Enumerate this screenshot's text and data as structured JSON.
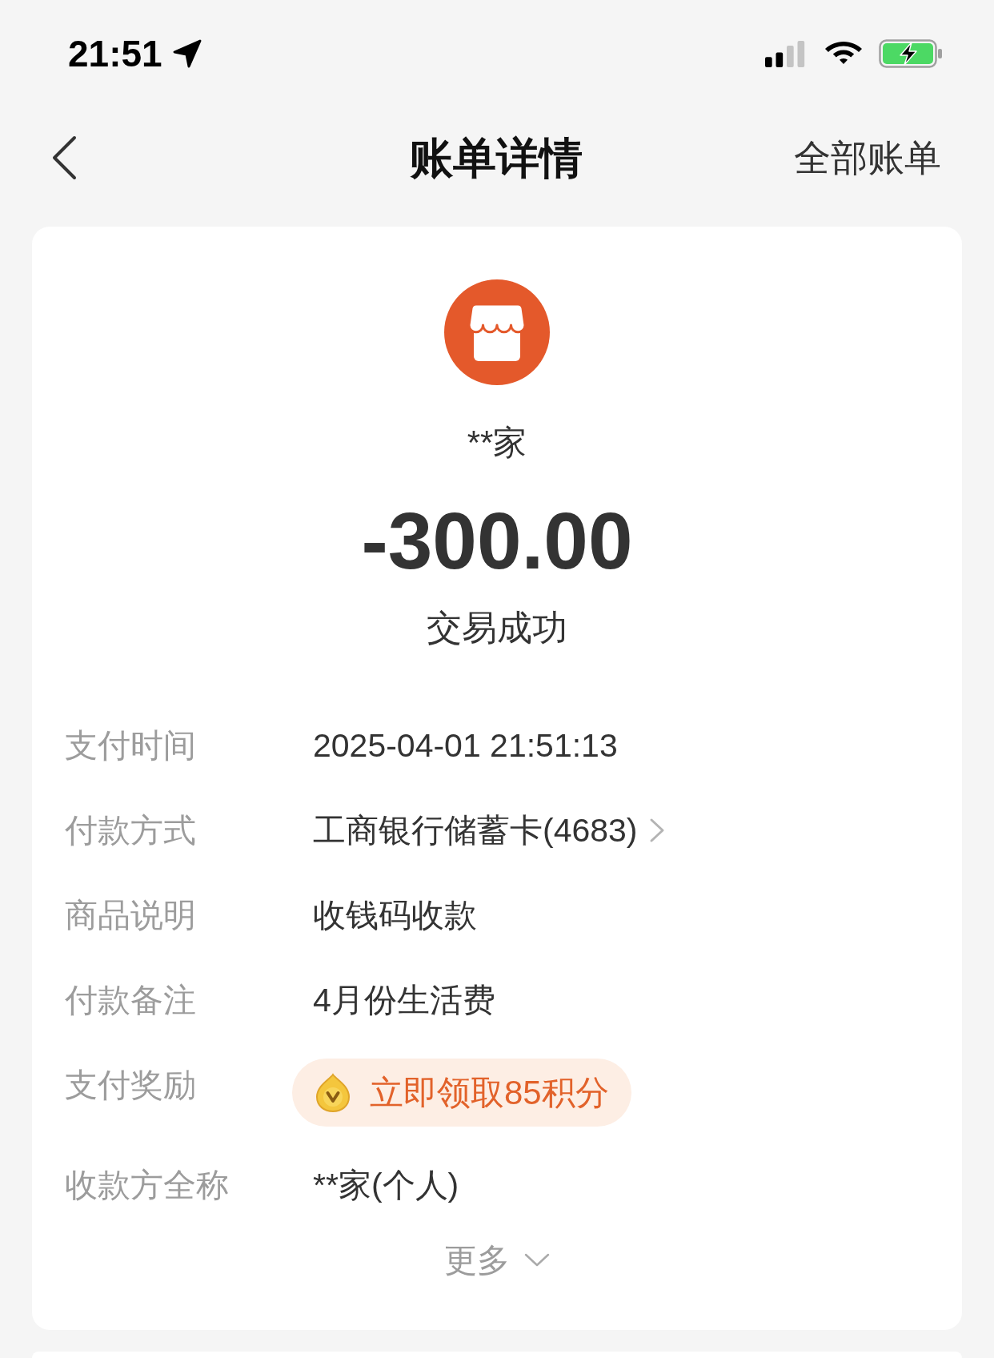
{
  "status_bar": {
    "time": "21:51"
  },
  "nav": {
    "title": "账单详情",
    "action": "全部账单"
  },
  "summary": {
    "merchant": "**家",
    "amount": "-300.00",
    "status": "交易成功"
  },
  "details": [
    {
      "kind": "text",
      "label": "支付时间",
      "value": "2025-04-01 21:51:13"
    },
    {
      "kind": "link",
      "label": "付款方式",
      "value": "工商银行储蓄卡(4683)"
    },
    {
      "kind": "text",
      "label": "商品说明",
      "value": "收钱码收款"
    },
    {
      "kind": "text",
      "label": "付款备注",
      "value": "4月份生活费"
    },
    {
      "kind": "reward",
      "label": "支付奖励",
      "value": "立即领取85积分"
    },
    {
      "kind": "text",
      "label": "收款方全称",
      "value": "**家(个人)"
    }
  ],
  "more": {
    "label": "更多"
  }
}
